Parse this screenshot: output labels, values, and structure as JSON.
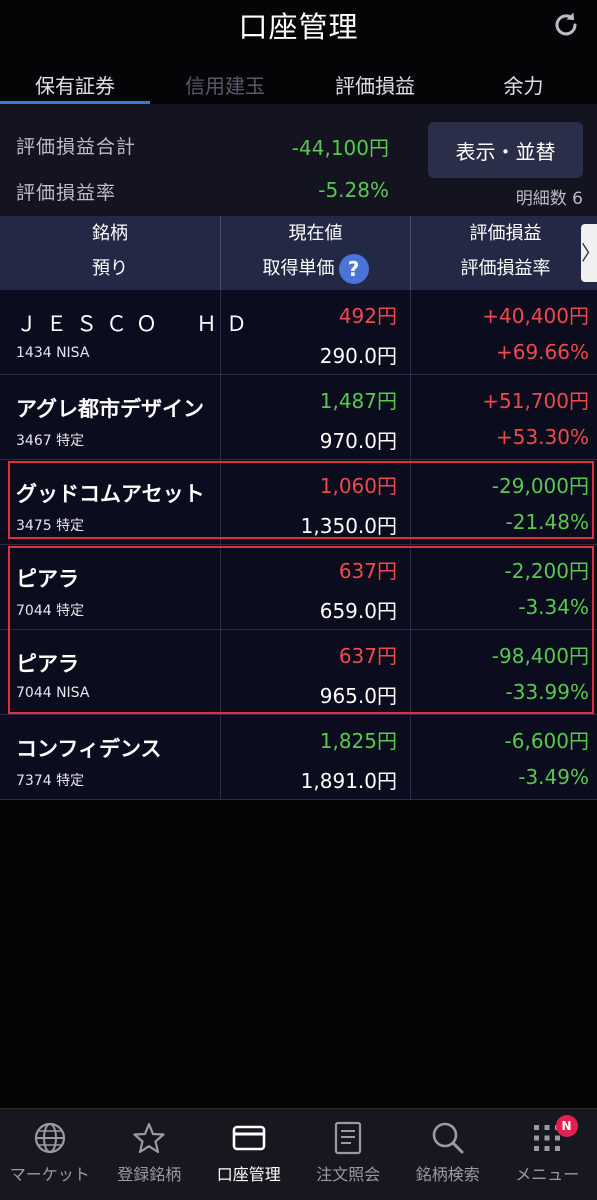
{
  "header": {
    "title": "口座管理"
  },
  "tabs": [
    {
      "label": "保有証券",
      "state": "active"
    },
    {
      "label": "信用建玉",
      "state": "disabled"
    },
    {
      "label": "評価損益",
      "state": "normal"
    },
    {
      "label": "余力",
      "state": "normal"
    }
  ],
  "summary": {
    "total_label": "評価損益合計",
    "total_value": "-44,100円",
    "rate_label": "評価損益率",
    "rate_value": "-5.28%",
    "sort_button": "表示・並替",
    "detail_count": "明細数 6"
  },
  "table_header": {
    "col1_line1": "銘柄",
    "col1_line2": "預り",
    "col2_line1": "現在値",
    "col2_line2": "取得単価",
    "col3_line1": "評価損益",
    "col3_line2": "評価損益率",
    "help_icon": "?",
    "scroll_icon": "〉"
  },
  "rows": [
    {
      "name": "ＪＥＳＣＯ　ＨＤ",
      "code": "1434 NISA",
      "price": "492円",
      "price_color": "red",
      "cost": "290.0円",
      "pl": "+40,400円",
      "pl_color": "red",
      "pl_rate": "+69.66%",
      "pl_rate_color": "red"
    },
    {
      "name": "アグレ都市デザイン",
      "code": "3467 特定",
      "price": "1,487円",
      "price_color": "green",
      "cost": "970.0円",
      "pl": "+51,700円",
      "pl_color": "red",
      "pl_rate": "+53.30%",
      "pl_rate_color": "red"
    },
    {
      "name": "グッドコムアセット",
      "code": "3475 特定",
      "price": "1,060円",
      "price_color": "red",
      "cost": "1,350.0円",
      "pl": "-29,000円",
      "pl_color": "green",
      "pl_rate": "-21.48%",
      "pl_rate_color": "green"
    },
    {
      "name": "ピアラ",
      "code": "7044 特定",
      "price": "637円",
      "price_color": "red",
      "cost": "659.0円",
      "pl": "-2,200円",
      "pl_color": "green",
      "pl_rate": "-3.34%",
      "pl_rate_color": "green"
    },
    {
      "name": "ピアラ",
      "code": "7044 NISA",
      "price": "637円",
      "price_color": "red",
      "cost": "965.0円",
      "pl": "-98,400円",
      "pl_color": "green",
      "pl_rate": "-33.99%",
      "pl_rate_color": "green"
    },
    {
      "name": "コンフィデンス",
      "code": "7374 特定",
      "price": "1,825円",
      "price_color": "green",
      "cost": "1,891.0円",
      "pl": "-6,600円",
      "pl_color": "green",
      "pl_rate": "-3.49%",
      "pl_rate_color": "green"
    }
  ],
  "bottom_nav": {
    "market": "マーケット",
    "watchlist": "登録銘柄",
    "account": "口座管理",
    "orders": "注文照会",
    "search": "銘柄検索",
    "menu": "メニュー",
    "menu_badge": "N"
  },
  "colors": {
    "red": "#ef4a4a",
    "green": "#57c94f",
    "accent": "#2f7fd6"
  }
}
